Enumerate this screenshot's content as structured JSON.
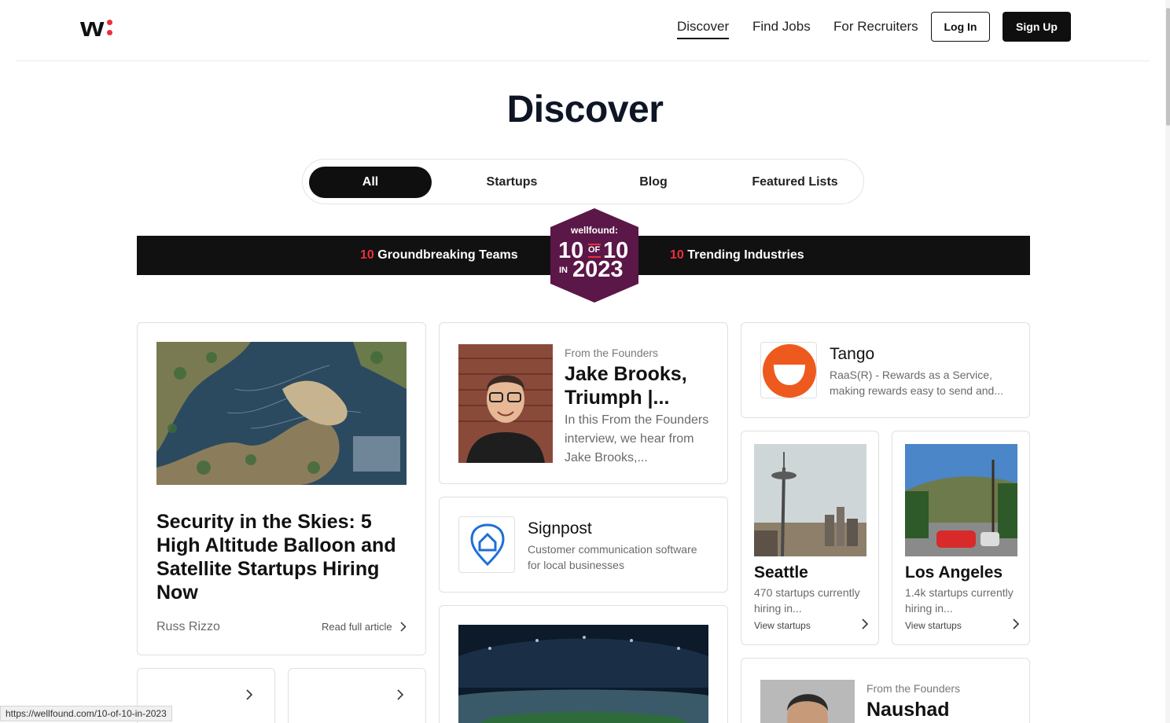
{
  "header": {
    "logo_text": "w",
    "nav": [
      {
        "label": "Discover"
      },
      {
        "label": "Find Jobs"
      },
      {
        "label": "For Recruiters"
      }
    ],
    "login_label": "Log In",
    "signup_label": "Sign Up"
  },
  "page_title": "Discover",
  "tabs": [
    {
      "label": "All",
      "active": true
    },
    {
      "label": "Startups"
    },
    {
      "label": "Blog"
    },
    {
      "label": "Featured Lists"
    }
  ],
  "banner": {
    "left": {
      "num": "10",
      "text": " Groundbreaking Teams"
    },
    "right": {
      "num": "10",
      "text": " Trending Industries"
    },
    "badge": {
      "brand": "wellfound:",
      "ten_a": "10",
      "of": "OF",
      "ten_b": "10",
      "in": "IN",
      "year": "2023"
    }
  },
  "article_card": {
    "title": "Security in the Skies: 5 High Altitude Balloon and Satellite Startups Hiring Now",
    "author": "Russ Rizzo",
    "read_label": "Read full article"
  },
  "founder_card": {
    "eyebrow": "From the Founders",
    "name": "Jake Brooks, Triumph |...",
    "desc": "In this From the Founders interview, we hear from Jake Brooks,..."
  },
  "company_cards": [
    {
      "name": "Tango",
      "desc": "RaaS(R) - Rewards as a Service, making rewards easy to send and..."
    },
    {
      "name": "Signpost",
      "desc": "Customer communication software for local businesses"
    }
  ],
  "city_cards": [
    {
      "name": "Seattle",
      "count": "470 startups currently hiring in...",
      "link": "View startups"
    },
    {
      "name": "Los Angeles",
      "count": "1.4k startups currently hiring in...",
      "link": "View startups"
    }
  ],
  "founder_card_2": {
    "eyebrow": "From the Founders",
    "name": "Naushad"
  },
  "status_url": "https://wellfound.com/10-of-10-in-2023",
  "colors": {
    "accent_red": "#ec2e3a",
    "badge_purple": "#5b1747",
    "dark": "#0f0f0f"
  }
}
